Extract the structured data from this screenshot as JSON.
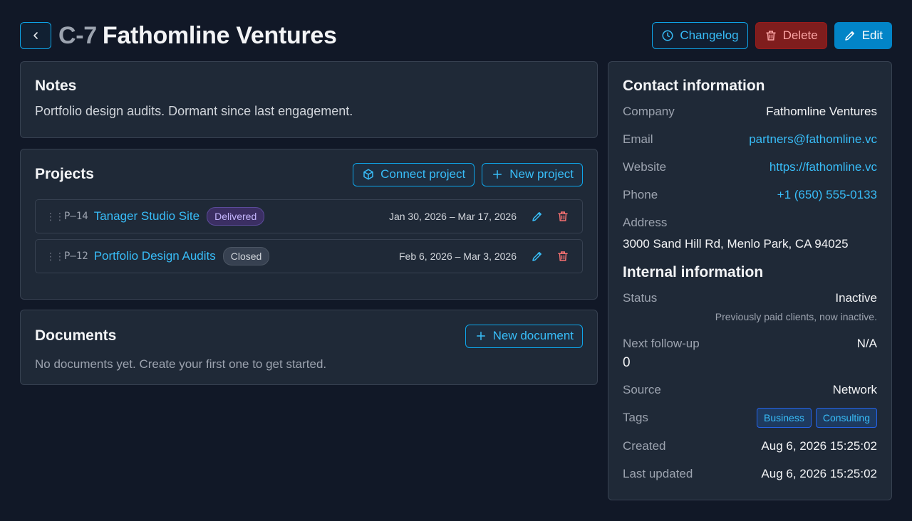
{
  "header": {
    "code": "C-7",
    "name": "Fathomline Ventures",
    "changelog_label": "Changelog",
    "delete_label": "Delete",
    "edit_label": "Edit"
  },
  "notes": {
    "title": "Notes",
    "text": "Portfolio design audits. Dormant since last engagement."
  },
  "projects": {
    "title": "Projects",
    "connect_label": "Connect project",
    "new_label": "New project",
    "items": [
      {
        "code": "P–14",
        "name": "Tanager Studio Site",
        "status": "Delivered",
        "dates": "Jan 30, 2026 – Mar 17, 2026"
      },
      {
        "code": "P–12",
        "name": "Portfolio Design Audits",
        "status": "Closed",
        "dates": "Feb 6, 2026 – Mar 3, 2026"
      }
    ]
  },
  "documents": {
    "title": "Documents",
    "new_label": "New document",
    "empty_text": "No documents yet. Create your first one to get started."
  },
  "contact": {
    "title": "Contact information",
    "company_label": "Company",
    "company": "Fathomline Ventures",
    "email_label": "Email",
    "email": "partners@fathomline.vc",
    "website_label": "Website",
    "website": "https://fathomline.vc",
    "phone_label": "Phone",
    "phone": "+1 (650) 555-0133",
    "address_label": "Address",
    "address": "3000 Sand Hill Rd, Menlo Park, CA 94025"
  },
  "internal": {
    "title": "Internal information",
    "status_label": "Status",
    "status": "Inactive",
    "status_desc": "Previously paid clients, now inactive.",
    "followup_label": "Next follow-up",
    "followup": "N/A",
    "followup_count": "0",
    "source_label": "Source",
    "source": "Network",
    "tags_label": "Tags",
    "tags": [
      "Business",
      "Consulting"
    ],
    "created_label": "Created",
    "created": "Aug 6, 2026 15:25:02",
    "updated_label": "Last updated",
    "updated": "Aug 6, 2026 15:25:02"
  },
  "colors": {
    "background": "#111827",
    "card": "#1f2937",
    "accent": "#38bdf8",
    "danger": "#7f1d1d",
    "primary": "#0284c7"
  }
}
